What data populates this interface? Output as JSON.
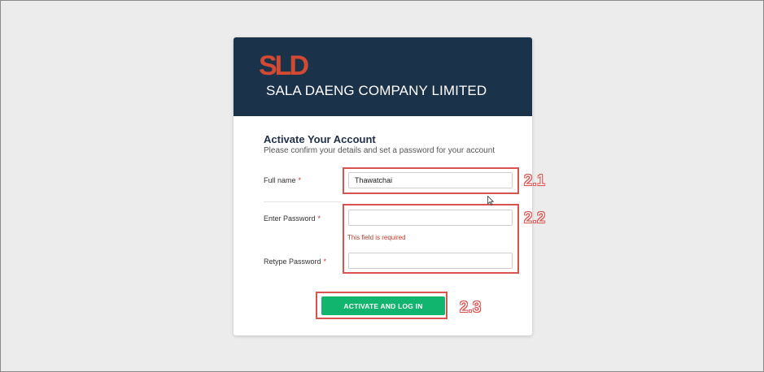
{
  "brand": {
    "logo_text": "SLD",
    "company_name": "SALA DAENG COMPANY LIMITED",
    "colors": {
      "header_bg": "#1b324b",
      "logo": "#d24a32",
      "primary_button": "#12b56e"
    }
  },
  "form": {
    "title": "Activate Your Account",
    "subtitle": "Please confirm your details and set a password for your account",
    "fields": [
      {
        "label": "Full name",
        "required_mark": "*",
        "value": "Thawatchai"
      },
      {
        "label": "Enter Password",
        "required_mark": "*",
        "value": "",
        "error": "This field is required"
      },
      {
        "label": "Retype Password",
        "required_mark": "*",
        "value": ""
      }
    ],
    "submit_label": "ACTIVATE AND LOG IN"
  },
  "annotations": {
    "step_1": "2.1",
    "step_2": "2.2",
    "step_3": "2.3",
    "color": "#d9534f"
  }
}
